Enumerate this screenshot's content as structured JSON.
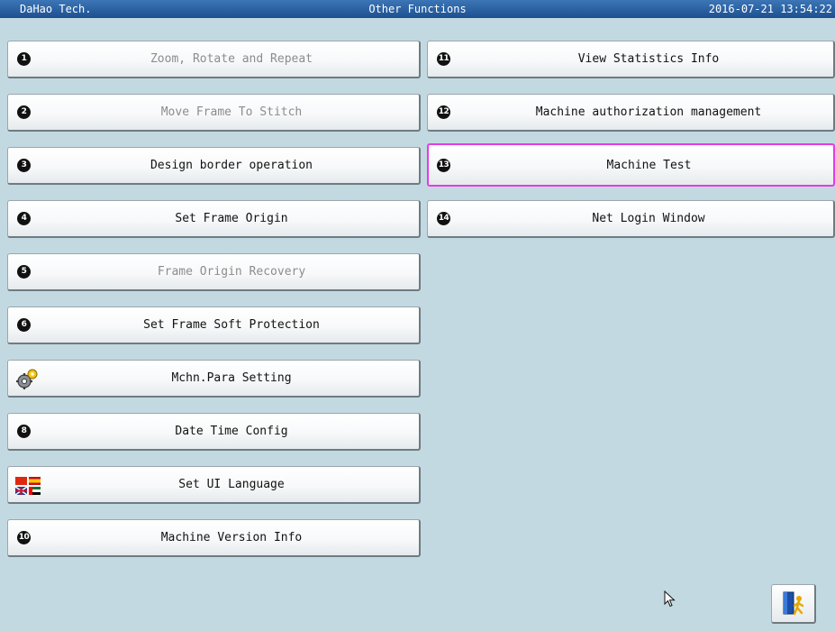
{
  "header": {
    "company": "DaHao Tech.",
    "title": "Other Functions",
    "datetime": "2016-07-21 13:54:22"
  },
  "menu_left": [
    {
      "num": "1",
      "label": "Zoom, Rotate and Repeat",
      "enabled": false
    },
    {
      "num": "2",
      "label": "Move Frame To Stitch",
      "enabled": false
    },
    {
      "num": "3",
      "label": "Design border operation",
      "enabled": true
    },
    {
      "num": "4",
      "label": "Set Frame Origin",
      "enabled": true
    },
    {
      "num": "5",
      "label": "Frame Origin Recovery",
      "enabled": false
    },
    {
      "num": "6",
      "label": "Set Frame Soft Protection",
      "enabled": true
    },
    {
      "icon": "gear-icon",
      "label": "Mchn.Para Setting",
      "enabled": true
    },
    {
      "num": "8",
      "label": "Date Time Config",
      "enabled": true
    },
    {
      "icon": "language-flags-icon",
      "label": "Set UI Language",
      "enabled": true
    },
    {
      "num": "10",
      "label": "Machine Version Info",
      "enabled": true
    }
  ],
  "menu_right": [
    {
      "num": "11",
      "label": "View Statistics Info",
      "enabled": true
    },
    {
      "num": "12",
      "label": "Machine authorization management",
      "enabled": true
    },
    {
      "num": "13",
      "label": "Machine Test",
      "enabled": true,
      "selected": true
    },
    {
      "num": "14",
      "label": "Net Login Window",
      "enabled": true
    }
  ],
  "exit_button": {
    "icon": "exit-door-icon"
  },
  "colors": {
    "background": "#c3d9e1",
    "title_bar": "#1d4f8f",
    "selection": "#e63be6",
    "disabled_text": "#8c8c8c"
  }
}
